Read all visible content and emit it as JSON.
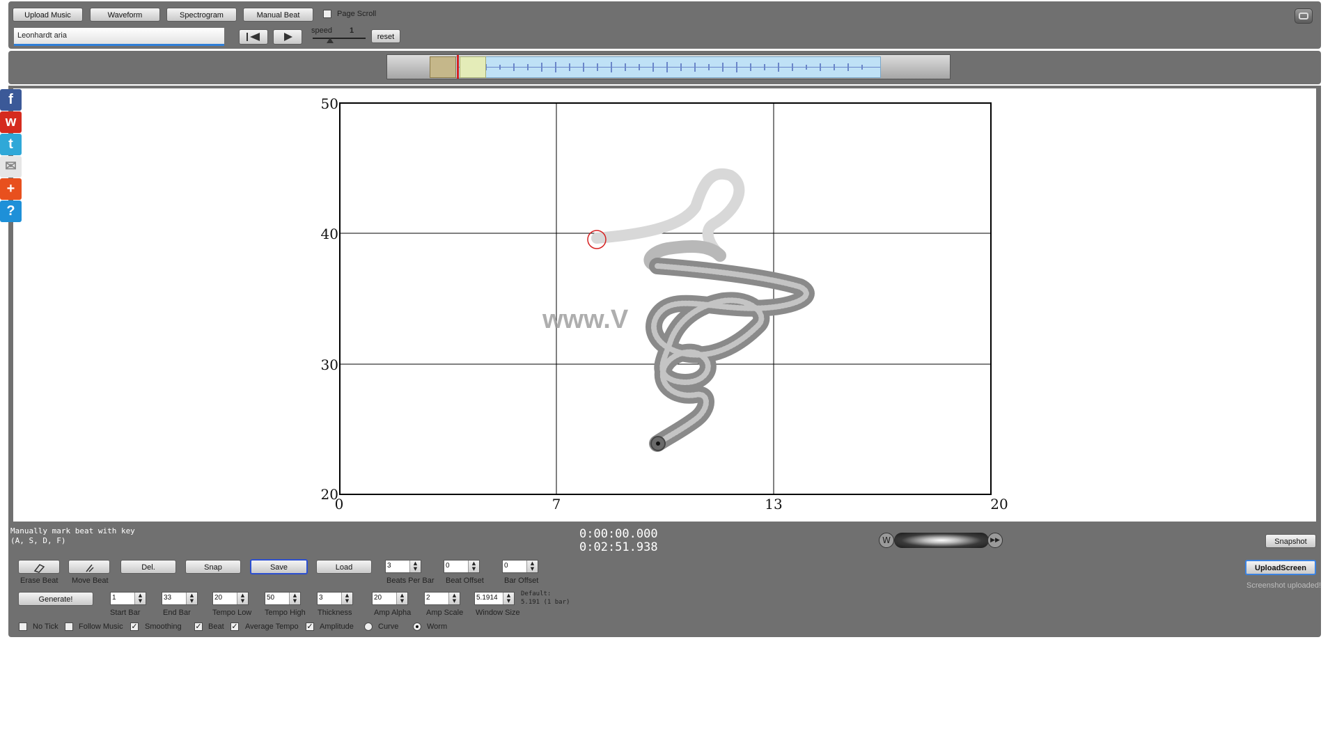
{
  "toolbar": {
    "upload_music": "Upload Music",
    "waveform": "Waveform",
    "spectrogram": "Spectrogram",
    "manual_beat": "Manual Beat",
    "page_scroll": "Page Scroll",
    "song_title": "Leonhardt aria",
    "speed_label": "speed",
    "speed_value": "1",
    "reset": "reset"
  },
  "sidebar": {
    "items": [
      {
        "name": "facebook-icon",
        "glyph": "f",
        "color": "#3b5998"
      },
      {
        "name": "weibo-icon",
        "glyph": "w",
        "color": "#d52b1e"
      },
      {
        "name": "twitter-icon",
        "glyph": "t",
        "color": "#2fa8d8"
      },
      {
        "name": "mail-icon",
        "glyph": "✉",
        "color": "#e6e6e6"
      },
      {
        "name": "add-icon",
        "glyph": "+",
        "color": "#e8501e"
      },
      {
        "name": "help-icon",
        "glyph": "?",
        "color": "#1e90d8"
      }
    ]
  },
  "chart_data": {
    "type": "line",
    "title": "",
    "xlabel": "",
    "ylabel": "",
    "x_ticks": [
      "0",
      "7",
      "13",
      "20"
    ],
    "y_ticks": [
      "50",
      "40",
      "30",
      "20"
    ],
    "xlim": [
      0,
      20
    ],
    "ylim": [
      20,
      50
    ],
    "grid": true,
    "watermark": "www.V"
  },
  "status": {
    "hint_line1": "Manually mark beat with key",
    "hint_line2": "(A, S, D, F)",
    "time_current": "0:00:00.000",
    "time_total": "0:02:51.938",
    "snapshot": "Snapshot",
    "upload_screen": "UploadScreen",
    "upload_status": "Screenshot uploaded!"
  },
  "controls": {
    "erase_beat": "Erase Beat",
    "move_beat": "Move Beat",
    "del": "Del.",
    "snap": "Snap",
    "save": "Save",
    "load": "Load",
    "generate": "Generate!",
    "beats_per_bar": {
      "label": "Beats Per Bar",
      "value": "3"
    },
    "beat_offset": {
      "label": "Beat Offset",
      "value": "0"
    },
    "bar_offset": {
      "label": "Bar Offset",
      "value": "0"
    },
    "start_bar": {
      "label": "Start Bar",
      "value": "1"
    },
    "end_bar": {
      "label": "End Bar",
      "value": "33"
    },
    "tempo_low": {
      "label": "Tempo Low",
      "value": "20"
    },
    "tempo_high": {
      "label": "Tempo High",
      "value": "50"
    },
    "thickness": {
      "label": "Thickness",
      "value": "3"
    },
    "amp_alpha": {
      "label": "Amp Alpha",
      "value": "20"
    },
    "amp_scale": {
      "label": "Amp Scale",
      "value": "2"
    },
    "window_size": {
      "label": "Window Size",
      "value": "5.1914"
    },
    "default_line1": "Default:",
    "default_line2": "5.191 (1 bar)",
    "no_tick": "No Tick",
    "follow_music": "Follow Music",
    "smoothing": "Smoothing",
    "beat": "Beat",
    "average_tempo": "Average Tempo",
    "amplitude": "Amplitude",
    "curve": "Curve",
    "worm": "Worm"
  }
}
